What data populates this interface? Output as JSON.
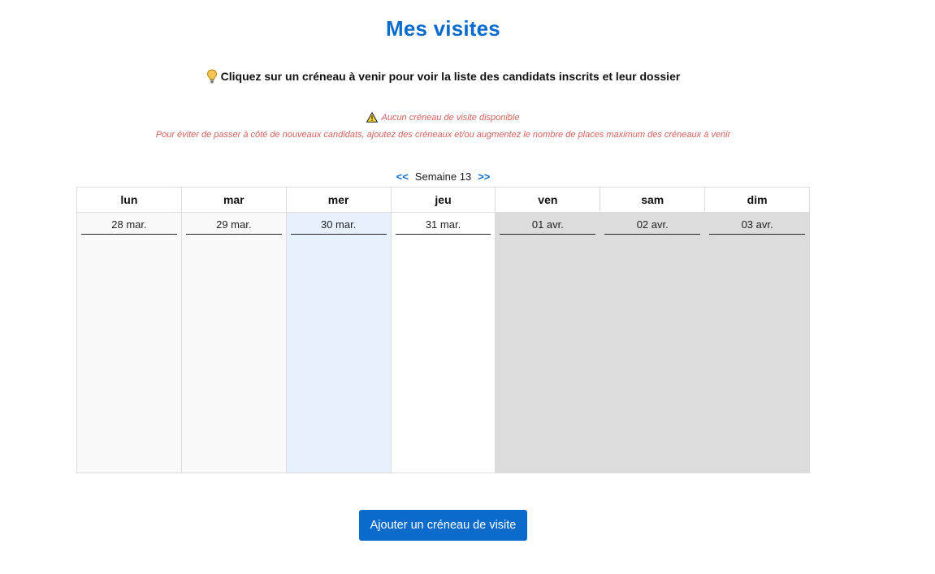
{
  "header": {
    "title": "Mes visites",
    "hint": "Cliquez sur un créneau à venir pour voir la liste des candidats inscrits et leur dossier"
  },
  "notice": {
    "warning": "Aucun créneau de visite disponible",
    "advice": "Pour éviter de passer à côté de nouveaux candidats, ajoutez des créneaux et/ou augmentez le nombre de places maximum des créneaux à venir"
  },
  "week_nav": {
    "prev": "<<",
    "label": "Semaine 13",
    "next": ">>"
  },
  "days": [
    {
      "name": "lun",
      "date": "28 mar."
    },
    {
      "name": "mar",
      "date": "29 mar."
    },
    {
      "name": "mer",
      "date": "30 mar."
    },
    {
      "name": "jeu",
      "date": "31 mar."
    },
    {
      "name": "ven",
      "date": "01 avr."
    },
    {
      "name": "sam",
      "date": "02 avr."
    },
    {
      "name": "dim",
      "date": "03 avr."
    }
  ],
  "actions": {
    "add_slot": "Ajouter un créneau de visite"
  },
  "colors": {
    "accent": "#0b6bcb",
    "warning_text": "#d0635e",
    "today_bg": "#e6f1fd",
    "unavailable_bg": "#dcdcdc"
  }
}
